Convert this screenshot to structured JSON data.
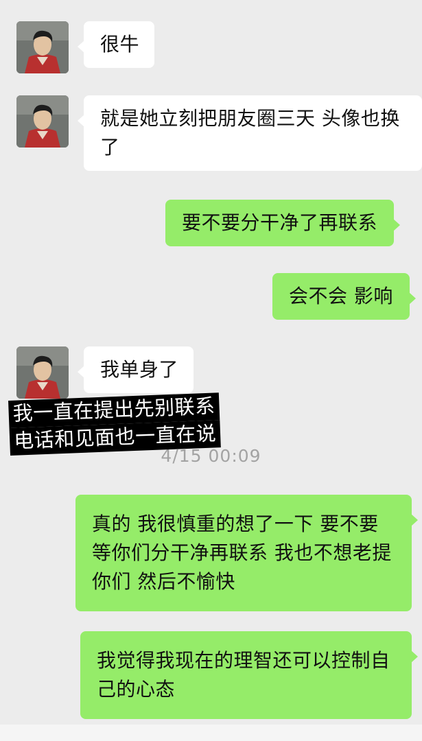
{
  "messages": [
    {
      "from": "other",
      "text": "很牛"
    },
    {
      "from": "other",
      "text": "就是她立刻把朋友圈三天 头像也换了"
    },
    {
      "from": "me",
      "text": "要不要分干净了再联系"
    },
    {
      "from": "me",
      "text": "会不会 影响"
    },
    {
      "from": "other",
      "text": "我单身了"
    },
    {
      "from": "me",
      "text": "真的 我很慎重的想了一下 要不要等你们分干净再联系 我也不想老提你们 然后不愉快"
    },
    {
      "from": "me",
      "text": "我觉得我现在的理智还可以控制自己的心态"
    }
  ],
  "timestamp": "4/15 00:09",
  "overlay_caption": {
    "lines": [
      "我一直在提出先别联系",
      "电话和见面也一直在说"
    ]
  },
  "avatar_icon": "avatar-basketball-player-icon",
  "colors": {
    "background": "#ececec",
    "incoming_bubble": "#ffffff",
    "outgoing_bubble": "#95ec69",
    "timestamp": "#a3a3a3"
  }
}
